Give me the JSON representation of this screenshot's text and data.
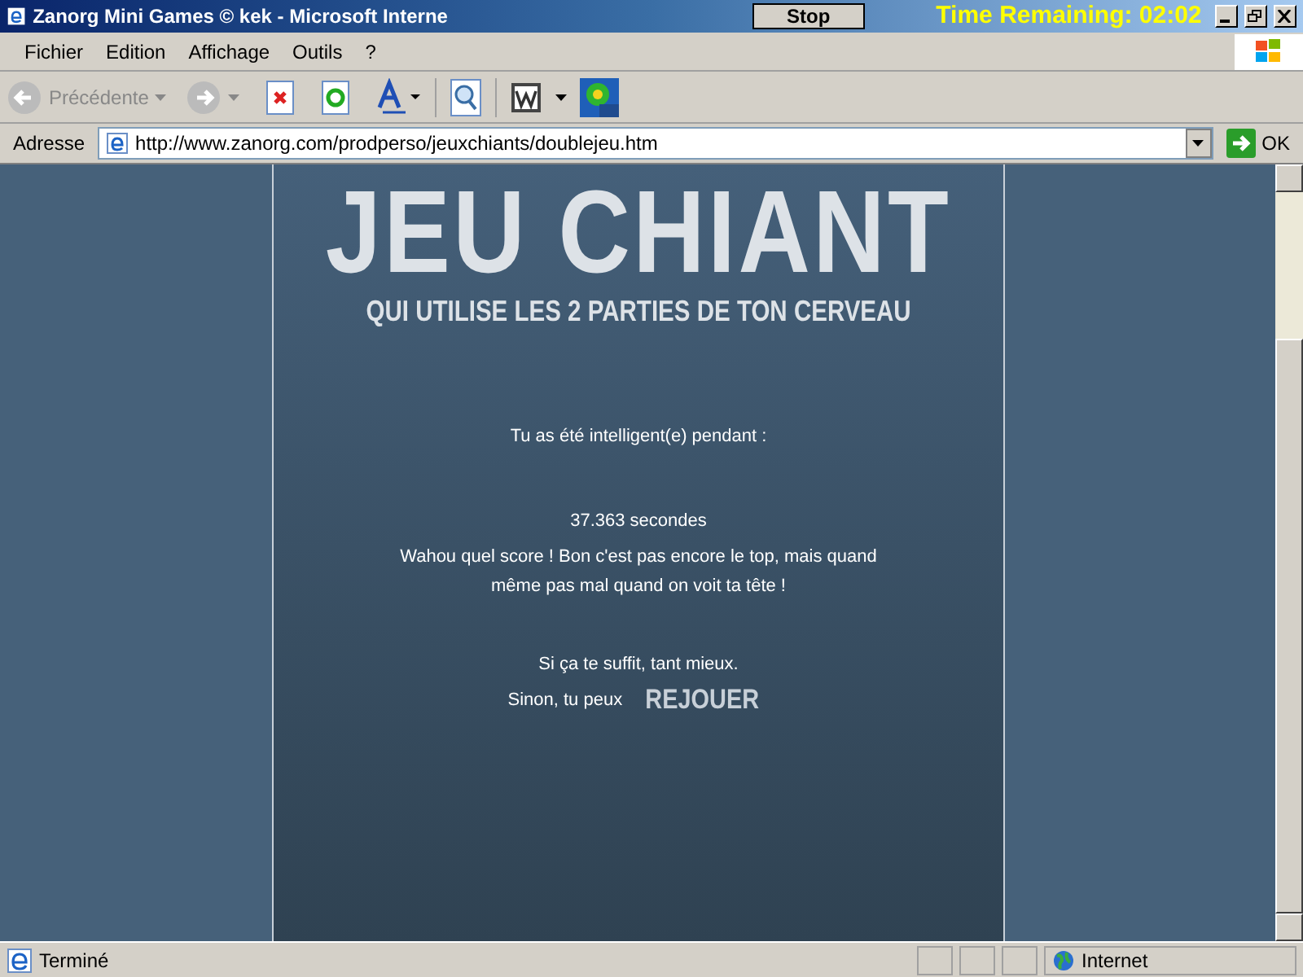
{
  "window": {
    "title": "Zanorg Mini Games © kek - Microsoft Interne",
    "stop_button": "Stop",
    "timer": "Time Remaining: 02:02"
  },
  "menu": [
    "Fichier",
    "Edition",
    "Affichage",
    "Outils",
    "?"
  ],
  "toolbar": {
    "back": "Précédente"
  },
  "address": {
    "label": "Adresse",
    "url": "http://www.zanorg.com/prodperso/jeuxchiants/doublejeu.htm",
    "go": "OK"
  },
  "page": {
    "title": "JEU CHIANT",
    "subtitle": "QUI UTILISE LES 2 PARTIES DE TON CERVEAU",
    "lines": [
      {
        "kind": "text",
        "text": "Tu as été intelligent(e) pendant :"
      },
      {
        "kind": "score",
        "text": "37.363 secondes"
      },
      {
        "kind": "text",
        "text": "Wahou quel score ! Bon c'est pas encore le top, mais quand même pas mal quand on voit ta tête !"
      },
      {
        "kind": "gap"
      },
      {
        "kind": "text",
        "text": "Si ça te suffit, tant mieux."
      },
      {
        "kind": "replay",
        "text": "Sinon, tu peux",
        "link": "REJOUER"
      }
    ]
  },
  "status_bar": {
    "text": "Terminé",
    "zone": "Internet"
  }
}
